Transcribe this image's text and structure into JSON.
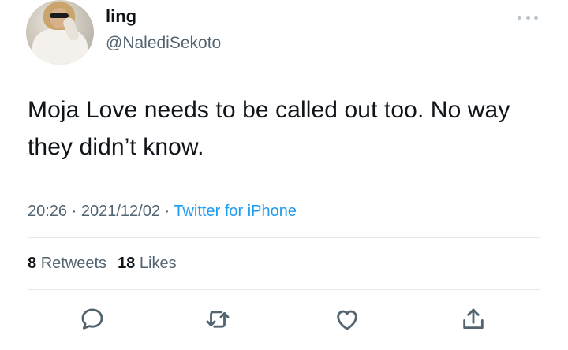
{
  "tweet": {
    "display_name": "ling",
    "handle": "@NalediSekoto",
    "text": "Moja Love needs to be called out too. No way they didn’t know.",
    "time": "20:26",
    "separator": " · ",
    "date": "2021/12/02",
    "source": "Twitter for iPhone",
    "retweets_count": "8",
    "retweets_label": "Retweets",
    "likes_count": "18",
    "likes_label": "Likes"
  },
  "icons": {
    "more": "more-icon",
    "reply": "reply-icon",
    "retweet": "retweet-icon",
    "like": "heart-icon",
    "share": "share-icon"
  },
  "colors": {
    "text": "#0f1419",
    "secondary": "#536471",
    "link": "#1d9bf0",
    "divider": "#e6e9eb"
  }
}
